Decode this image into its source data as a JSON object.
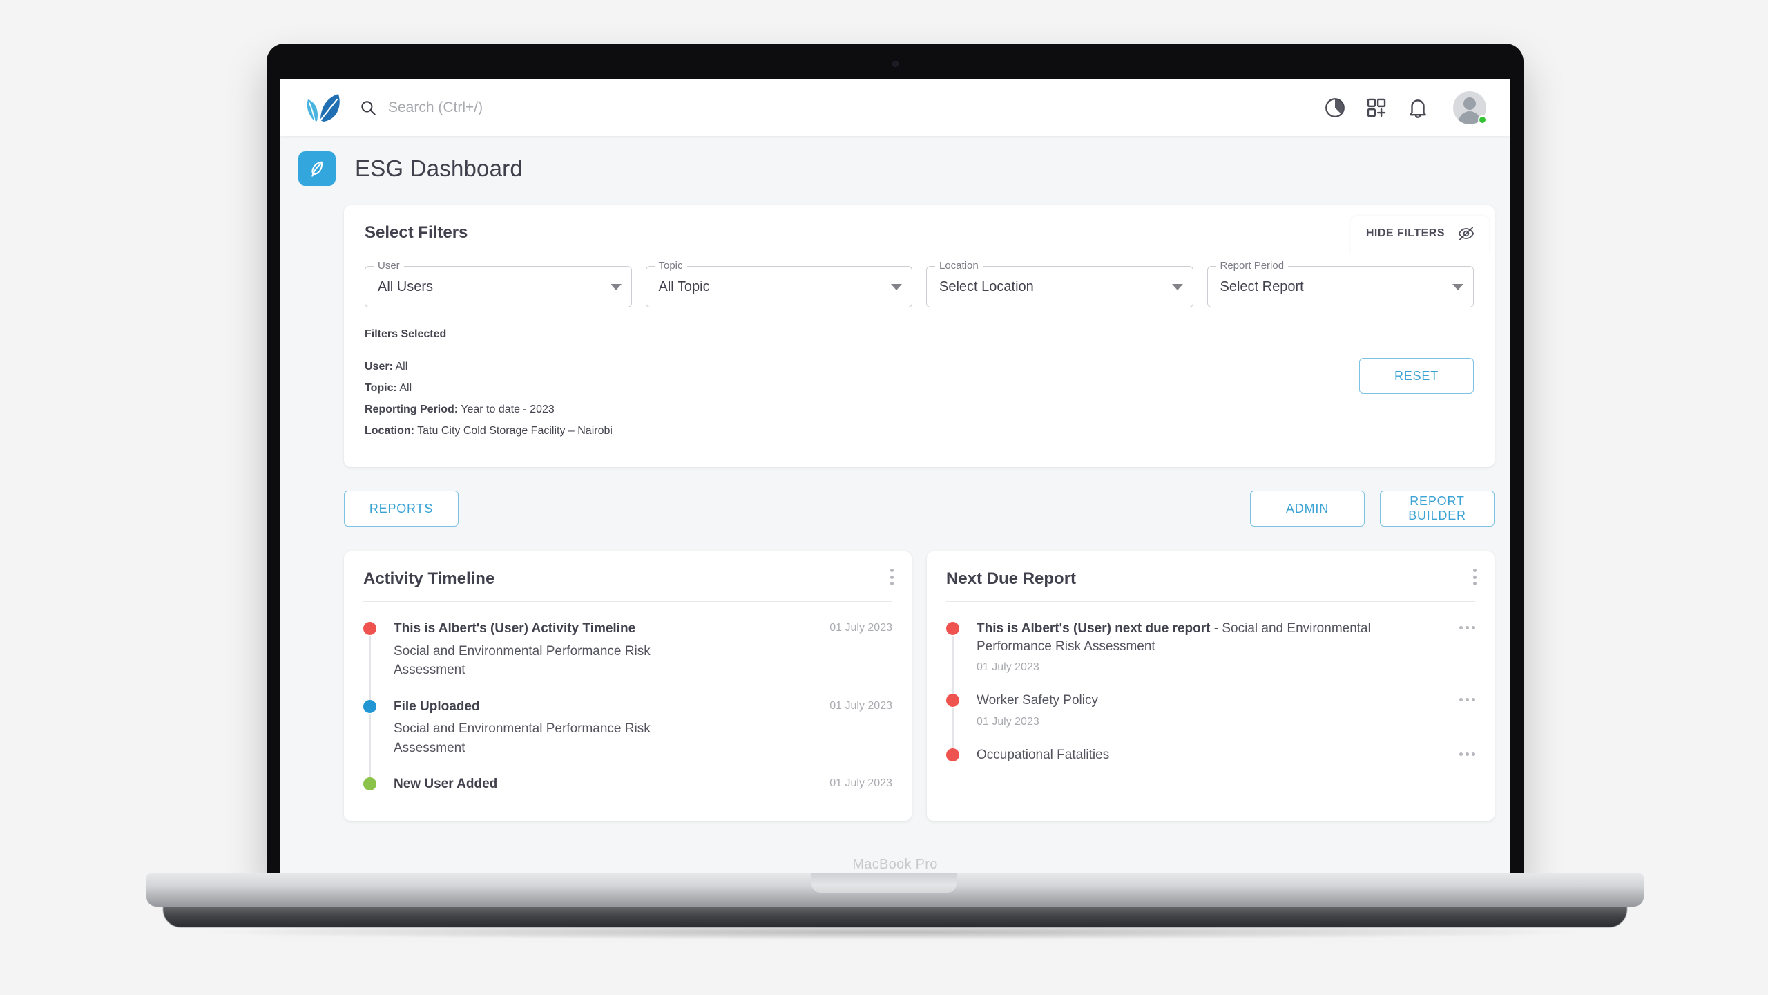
{
  "device": {
    "label": "MacBook Pro"
  },
  "appbar": {
    "logo_icon": "leaf-logo",
    "search": {
      "placeholder": "Search (Ctrl+/)",
      "value": ""
    },
    "actions": [
      {
        "icon": "pie-chart-icon",
        "name": "analytics-button"
      },
      {
        "icon": "grid-plus-icon",
        "name": "apps-button"
      },
      {
        "icon": "bell-icon",
        "name": "notifications-button"
      }
    ],
    "avatar": {
      "icon": "avatar",
      "status": "online"
    }
  },
  "page": {
    "title": "ESG Dashboard",
    "nav_tile_icon": "leaf-icon"
  },
  "hide_filters": {
    "label": "HIDE FILTERS",
    "icon": "eye-slash-icon"
  },
  "filters": {
    "title": "Select Filters",
    "fields": [
      {
        "label": "User",
        "value": "All Users"
      },
      {
        "label": "Topic",
        "value": "All Topic"
      },
      {
        "label": "Location",
        "value": "Select Location"
      },
      {
        "label": "Report Period",
        "value": "Select Report"
      }
    ],
    "selected_label": "Filters Selected",
    "selected": [
      {
        "key": "User:",
        "value": "All"
      },
      {
        "key": "Topic:",
        "value": "All"
      },
      {
        "key": "Reporting Period:",
        "value": "Year to date - 2023"
      },
      {
        "key": "Location:",
        "value": "Tatu City Cold Storage Facility – Nairobi"
      }
    ],
    "reset_label": "RESET"
  },
  "actions": {
    "reports_label": "REPORTS",
    "admin_label": "ADMIN",
    "report_builder_label": "REPORT BUILDER"
  },
  "activity_timeline": {
    "title": "Activity Timeline",
    "items": [
      {
        "dot_color": "#ef5350",
        "title": "This is Albert's (User) Activity Timeline",
        "date": "01 July 2023",
        "desc": "Social and Environmental Performance Risk Assessment"
      },
      {
        "dot_color": "#2196d3",
        "title": "File Uploaded",
        "date": "01 July 2023",
        "desc": "Social and Environmental Performance Risk Assessment"
      },
      {
        "dot_color": "#8bc34a",
        "title": "New User Added",
        "date": "01 July 2023",
        "desc": ""
      }
    ]
  },
  "next_due_report": {
    "title": "Next Due Report",
    "items": [
      {
        "dot_color": "#ef5350",
        "title": "This is Albert's (User) next due report",
        "title_rest": " - Social and Environmental Performance Risk Assessment",
        "date": "01 July 2023"
      },
      {
        "dot_color": "#ef5350",
        "title": "Worker Safety Policy",
        "title_rest": "",
        "date": "01 July 2023"
      },
      {
        "dot_color": "#ef5350",
        "title": "Occupational Fatalities",
        "title_rest": "",
        "date": ""
      }
    ]
  },
  "colors": {
    "accent": "#33a6dd",
    "logo_dark": "#1f6fb2",
    "logo_light": "#4ab4e0",
    "text": "#41414d"
  }
}
